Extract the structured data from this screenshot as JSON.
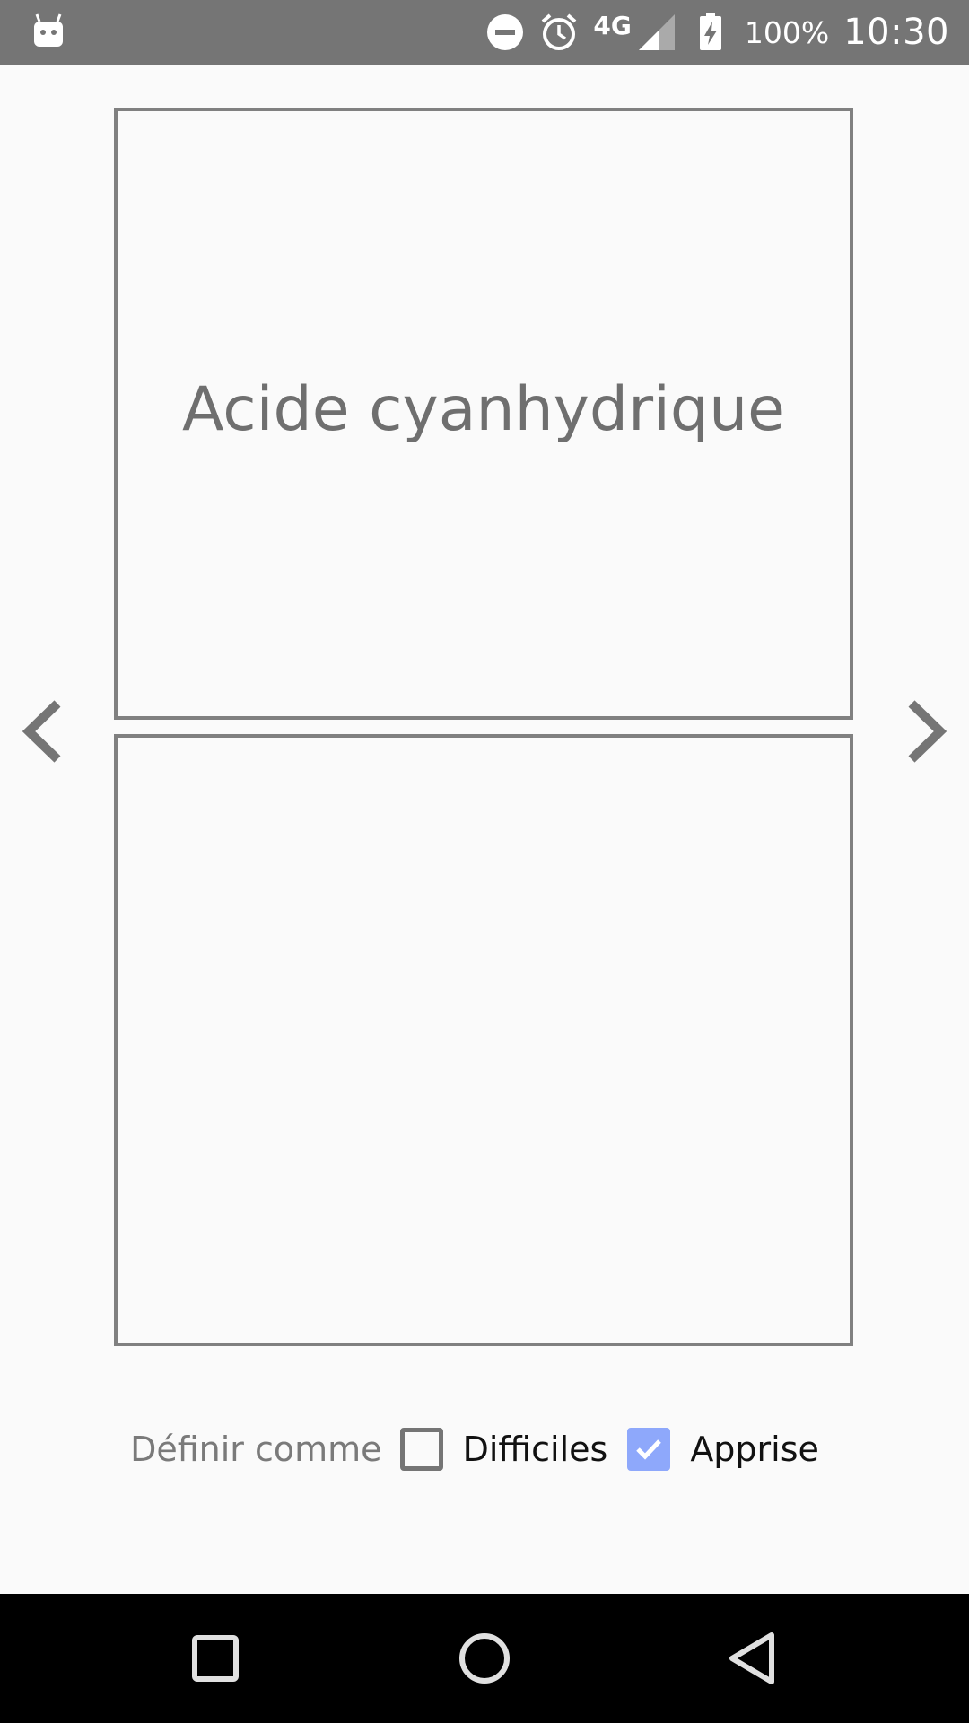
{
  "status_bar": {
    "left_icon": "android-debug-icon",
    "icons": [
      "do-not-disturb-icon",
      "alarm-icon",
      "signal-icon",
      "battery-charging-icon"
    ],
    "network": "4G",
    "battery": "100%",
    "time": "10:30"
  },
  "flashcard": {
    "front_text": "Acide cyanhydrique",
    "back_text": ""
  },
  "navigation": {
    "prev_icon": "chevron-left-icon",
    "next_icon": "chevron-right-icon"
  },
  "mark": {
    "label": "Définir comme",
    "options": [
      {
        "label": "Difficiles",
        "checked": false
      },
      {
        "label": "Apprise",
        "checked": true
      }
    ]
  },
  "colors": {
    "status_bar": "#757575",
    "checkbox_checked": "#8ea8fb",
    "card_border": "#808080"
  },
  "system_nav": {
    "icons": [
      "recent-apps-icon",
      "home-icon",
      "back-icon"
    ]
  }
}
